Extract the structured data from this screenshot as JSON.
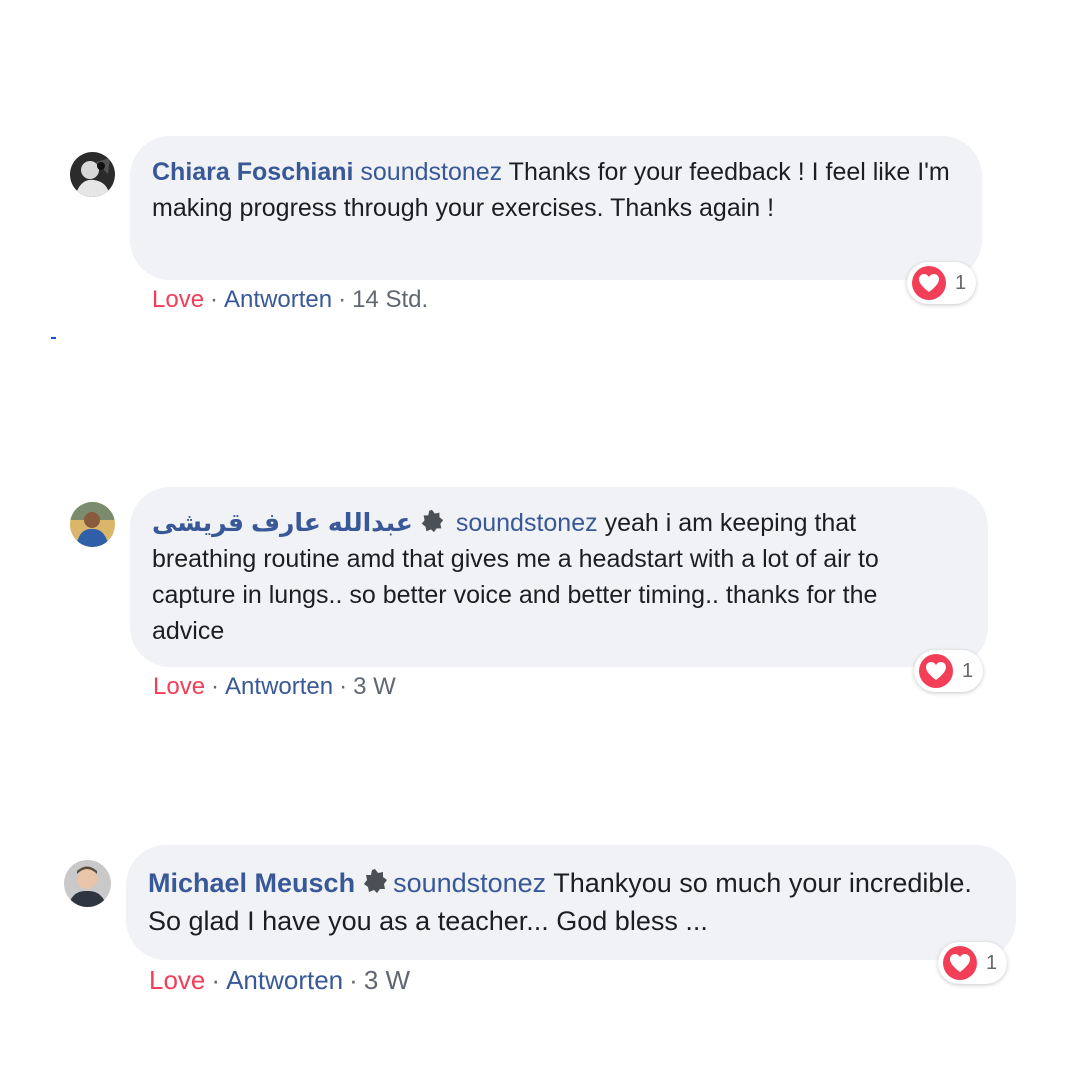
{
  "comments": [
    {
      "author": "Chiara Foschiani",
      "author_rtl": false,
      "has_badge": false,
      "mention": "soundstonez",
      "text": " Thanks for your feedback ! I feel like I'm making progress through your exercises. Thanks again !",
      "love_label": "Love",
      "reply_label": "Antworten",
      "separator": "·",
      "time": "14 Std.",
      "reaction_count": "1",
      "avatar_icon": "avatar-dark-photo"
    },
    {
      "author": "عبدالله عارف قریشی",
      "author_rtl": true,
      "has_badge": true,
      "mention": "soundstonez",
      "text": " yeah i am keeping that breathing routine amd that gives me a headstart with a lot of air to capture in lungs.. so better voice and better timing.. thanks for the advice",
      "love_label": "Love",
      "reply_label": "Antworten",
      "separator": "·",
      "time": "3 W",
      "reaction_count": "1",
      "avatar_icon": "avatar-person-photo"
    },
    {
      "author": "Michael Meusch",
      "author_rtl": false,
      "has_badge": true,
      "mention": "soundstonez",
      "text": " Thankyou so much your incredible. So glad I have you as a teacher... God bless ...",
      "love_label": "Love",
      "reply_label": "Antworten",
      "separator": "·",
      "time": "3 W",
      "reaction_count": "1",
      "avatar_icon": "avatar-man-photo"
    }
  ],
  "colors": {
    "bubble_bg": "#f0f2f5",
    "author": "#385898",
    "love": "#f33e58",
    "heart": "#f33e58",
    "meta": "#606770"
  }
}
